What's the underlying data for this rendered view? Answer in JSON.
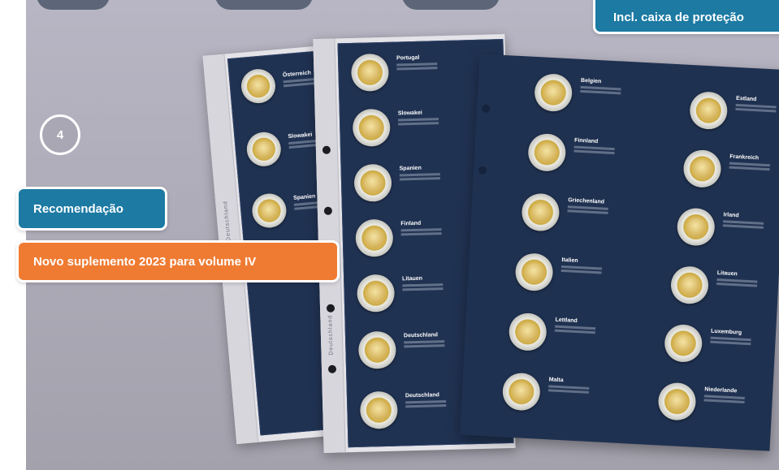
{
  "step": {
    "number": "4"
  },
  "badges": {
    "recommendation": "Recomendação",
    "new_supplement": "Novo suplemento 2023 para volume IV",
    "protection_box": "Incl. caixa de proteção"
  },
  "pages": {
    "back_sheet": [
      {
        "country": "Österreich"
      },
      {
        "country": "Slowakei"
      },
      {
        "country": "Spanien"
      }
    ],
    "middle_sheet": [
      {
        "country": "Portugal"
      },
      {
        "country": "Slowakei"
      },
      {
        "country": "Spanien"
      },
      {
        "country": "Finland"
      },
      {
        "country": "Litauen"
      },
      {
        "country": "Deutschland"
      },
      {
        "country": "Deutschland"
      }
    ],
    "front_sheet_left": [
      {
        "country": "Belgien"
      },
      {
        "country": "Finnland"
      },
      {
        "country": "Griechenland"
      },
      {
        "country": "Italien"
      },
      {
        "country": "Lettland"
      },
      {
        "country": "Malta"
      }
    ],
    "front_sheet_right": [
      {
        "country": "Estland"
      },
      {
        "country": "Frankreich"
      },
      {
        "country": "Irland"
      },
      {
        "country": "Litauen"
      },
      {
        "country": "Luxemburg"
      },
      {
        "country": "Niederlande"
      }
    ]
  },
  "sleeve_label": "Deutschland"
}
